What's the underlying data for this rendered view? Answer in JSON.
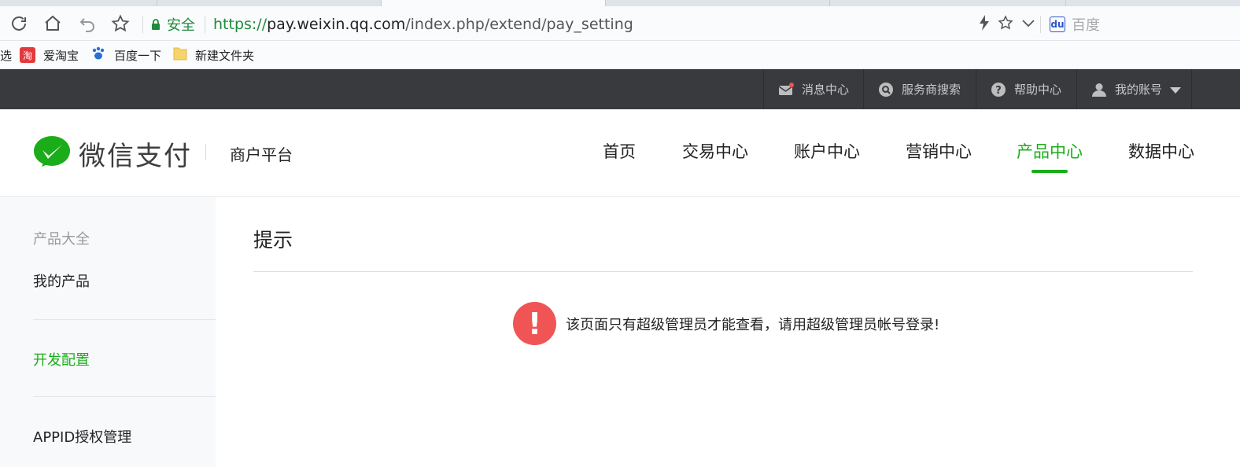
{
  "browser": {
    "secure_label": "安全",
    "url": {
      "scheme": "https://",
      "host": "pay.weixin.qq.com",
      "path": "/index.php/extend/pay_setting"
    },
    "search_engine": "百度",
    "bookmarks": [
      {
        "label": "选",
        "icon": "bookmark-icon"
      },
      {
        "label": "爱淘宝",
        "icon": "taobao-icon",
        "icon_text": "淘"
      },
      {
        "label": "百度一下",
        "icon": "baidu-icon"
      },
      {
        "label": "新建文件夹",
        "icon": "folder-icon"
      }
    ]
  },
  "topbar": {
    "items": [
      {
        "label": "消息中心",
        "icon": "message-icon"
      },
      {
        "label": "服务商搜索",
        "icon": "search-icon"
      },
      {
        "label": "帮助中心",
        "icon": "help-icon"
      },
      {
        "label": "我的账号",
        "icon": "user-icon"
      }
    ]
  },
  "header": {
    "brand": "微信支付",
    "platform": "商户平台",
    "nav": [
      "首页",
      "交易中心",
      "账户中心",
      "营销中心",
      "产品中心",
      "数据中心"
    ],
    "active_nav": "产品中心"
  },
  "sidebar": {
    "heading": "产品大全",
    "items": [
      "我的产品",
      "开发配置",
      "APPID授权管理"
    ],
    "active_item": "开发配置"
  },
  "content": {
    "title": "提示",
    "alert_icon_text": "!",
    "message": "该页面只有超级管理员才能查看，请用超级管理员帐号登录!"
  },
  "colors": {
    "accent": "#1aad19",
    "topbar": "#393a3e",
    "alert": "#f05454"
  }
}
